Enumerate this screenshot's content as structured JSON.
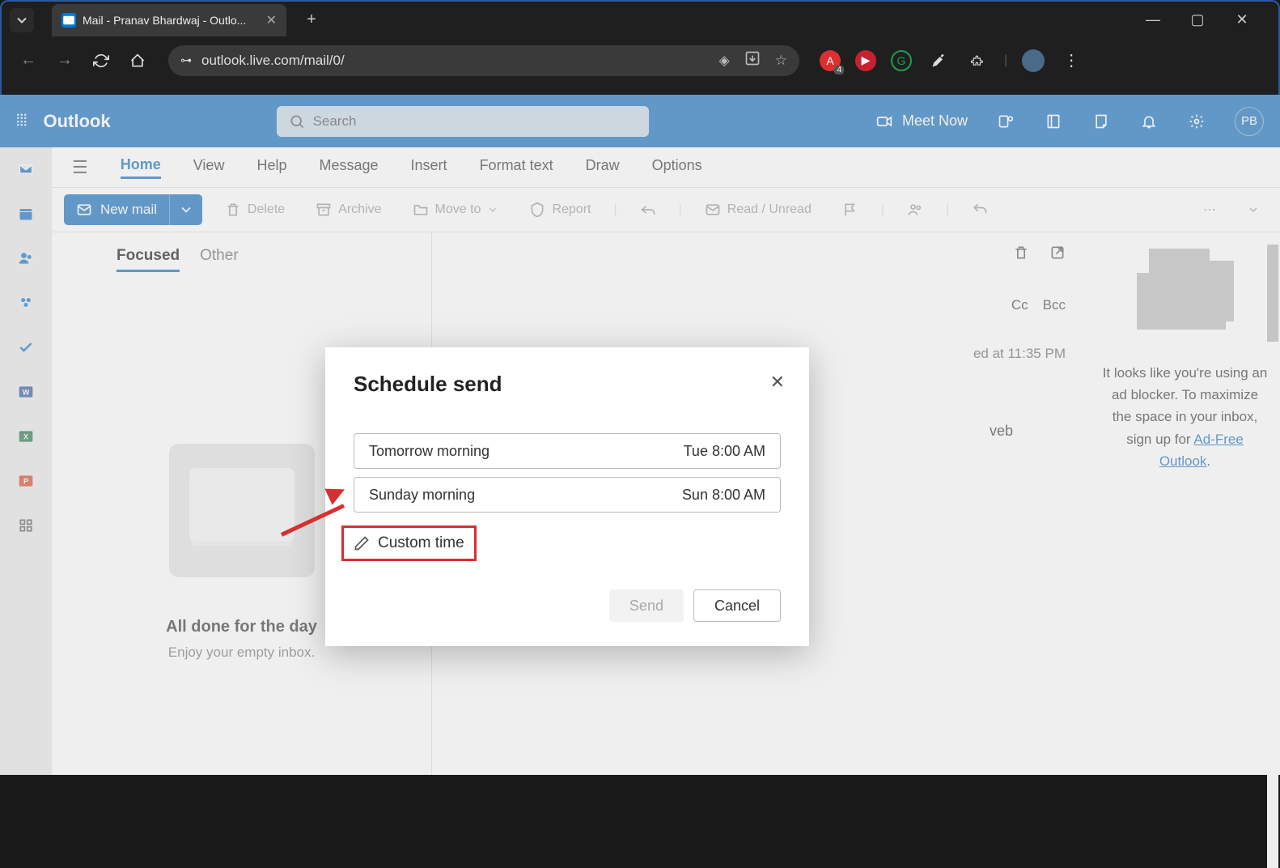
{
  "browser": {
    "tab_title": "Mail - Pranav Bhardwaj - Outlo...",
    "url": "outlook.live.com/mail/0/",
    "ext_badge": "4"
  },
  "outlook": {
    "brand": "Outlook",
    "search_placeholder": "Search",
    "meet_now": "Meet Now",
    "avatar_initials": "PB",
    "menubar": {
      "home": "Home",
      "view": "View",
      "help": "Help",
      "message": "Message",
      "insert": "Insert",
      "format": "Format text",
      "draw": "Draw",
      "options": "Options"
    },
    "toolbar": {
      "new_mail": "New mail",
      "delete": "Delete",
      "archive": "Archive",
      "move_to": "Move to",
      "report": "Report",
      "read_unread": "Read / Unread"
    },
    "list": {
      "focused": "Focused",
      "other": "Other",
      "empty_title": "All done for the day",
      "empty_sub": "Enjoy your empty inbox."
    },
    "read": {
      "cc": "Cc",
      "bcc": "Bcc",
      "saved": "ed at 11:35 PM",
      "web_fragment": "veb"
    },
    "ad": {
      "text_1": "It looks like you're using an ad blocker. To maximize the space in your inbox, sign up for ",
      "link": "Ad-Free Outlook",
      "period": "."
    }
  },
  "modal": {
    "title": "Schedule send",
    "opt1_label": "Tomorrow morning",
    "opt1_time": "Tue 8:00 AM",
    "opt2_label": "Sunday morning",
    "opt2_time": "Sun 8:00 AM",
    "custom": "Custom time",
    "send": "Send",
    "cancel": "Cancel"
  }
}
